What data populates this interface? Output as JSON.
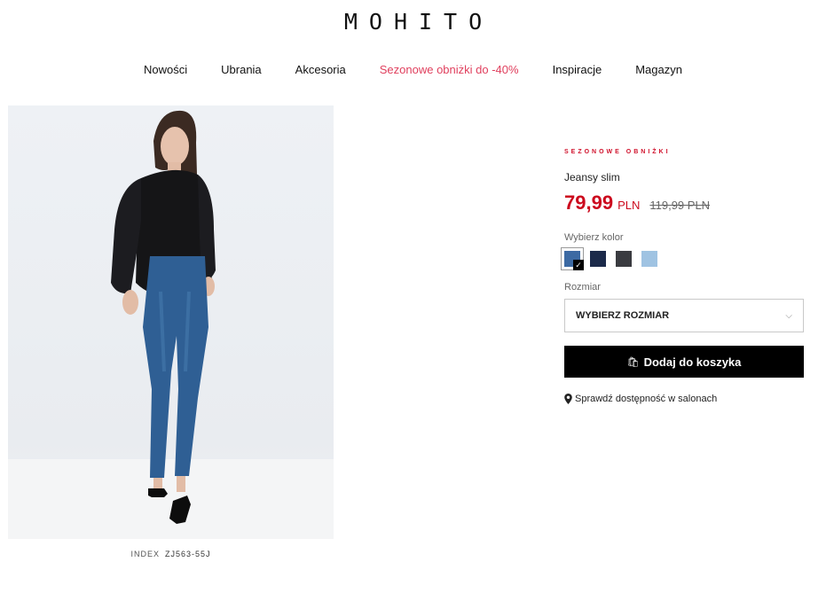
{
  "header": {
    "logo": "MOHITO"
  },
  "nav": {
    "items": [
      {
        "label": "Nowości"
      },
      {
        "label": "Ubrania"
      },
      {
        "label": "Akcesoria"
      },
      {
        "label": "Sezonowe obniżki do -40%"
      },
      {
        "label": "Inspiracje"
      },
      {
        "label": "Magazyn"
      }
    ],
    "sale_color": "#e0405e"
  },
  "product": {
    "badge": "SEZONOWE OBNIŻKI",
    "name": "Jeansy slim",
    "price": "79,99",
    "currency": "PLN",
    "old_price": "119,99 PLN",
    "index_label": "INDEX",
    "index_code": "ZJ563-55J",
    "price_color": "#cc0a1e"
  },
  "colors": {
    "label": "Wybierz kolor",
    "swatches": [
      {
        "name": "denim-blue",
        "hex": "#3d6aa3",
        "selected": true
      },
      {
        "name": "navy",
        "hex": "#1c2a4a",
        "selected": false
      },
      {
        "name": "dark-grey",
        "hex": "#3a3b40",
        "selected": false
      },
      {
        "name": "light-blue",
        "hex": "#9fc3e2",
        "selected": false
      }
    ]
  },
  "size": {
    "label": "Rozmiar",
    "select_value": "WYBIERZ ROZMIAR"
  },
  "cart": {
    "button_label": "Dodaj do koszyka",
    "icon": "shopping-bag-icon"
  },
  "store": {
    "link_label": "Sprawdź dostępność w salonach",
    "icon": "map-pin-icon"
  }
}
